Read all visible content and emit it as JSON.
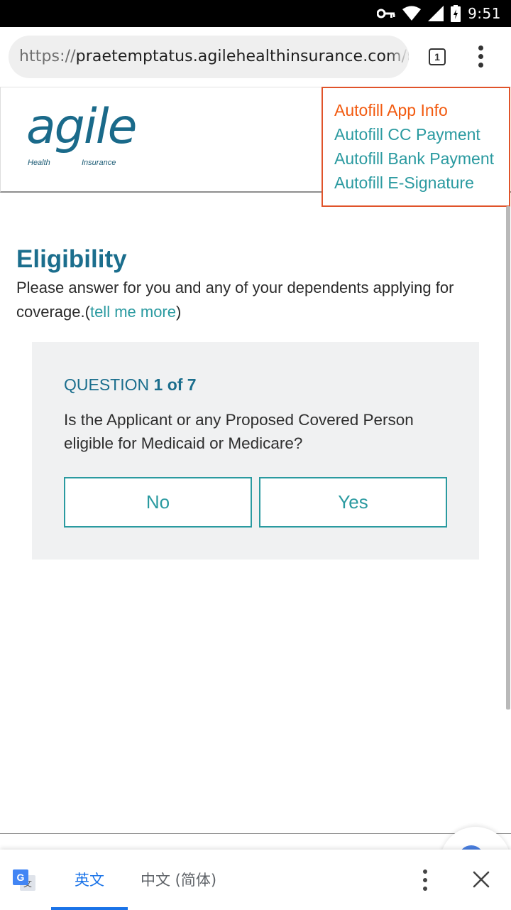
{
  "status_bar": {
    "time": "9:51"
  },
  "browser": {
    "url_scheme": "https://",
    "url_host": "praetemptatus.agilehealthinsurance.com/t",
    "tab_count": "1"
  },
  "site": {
    "logo_text": "agile",
    "logo_health": "Health",
    "logo_insurance": "Insurance",
    "logo_reg": "®"
  },
  "autofill": {
    "items": [
      {
        "label": "Autofill App Info"
      },
      {
        "label": "Autofill CC Payment"
      },
      {
        "label": "Autofill Bank Payment"
      },
      {
        "label": "Autofill E-Signature"
      }
    ]
  },
  "main": {
    "title": "Eligibility",
    "intro_text": "Please answer for you and any of your dependents applying for coverage.(",
    "intro_link": "tell me more",
    "intro_close": ")"
  },
  "question": {
    "label": "QUESTION ",
    "progress": "1 of 7",
    "text": "Is the Applicant or any Proposed Covered Person eligible for Medicaid or Medicare?",
    "no_label": "No",
    "yes_label": "Yes"
  },
  "translate": {
    "source_lang": "英文",
    "target_lang": "中文 (简体)",
    "g_letter": "G",
    "wen": "文"
  },
  "colors": {
    "brand": "#1b6e8d",
    "accent": "#2a9aa0",
    "autofill_active": "#f25a0f",
    "translate_blue": "#1a73e8"
  }
}
